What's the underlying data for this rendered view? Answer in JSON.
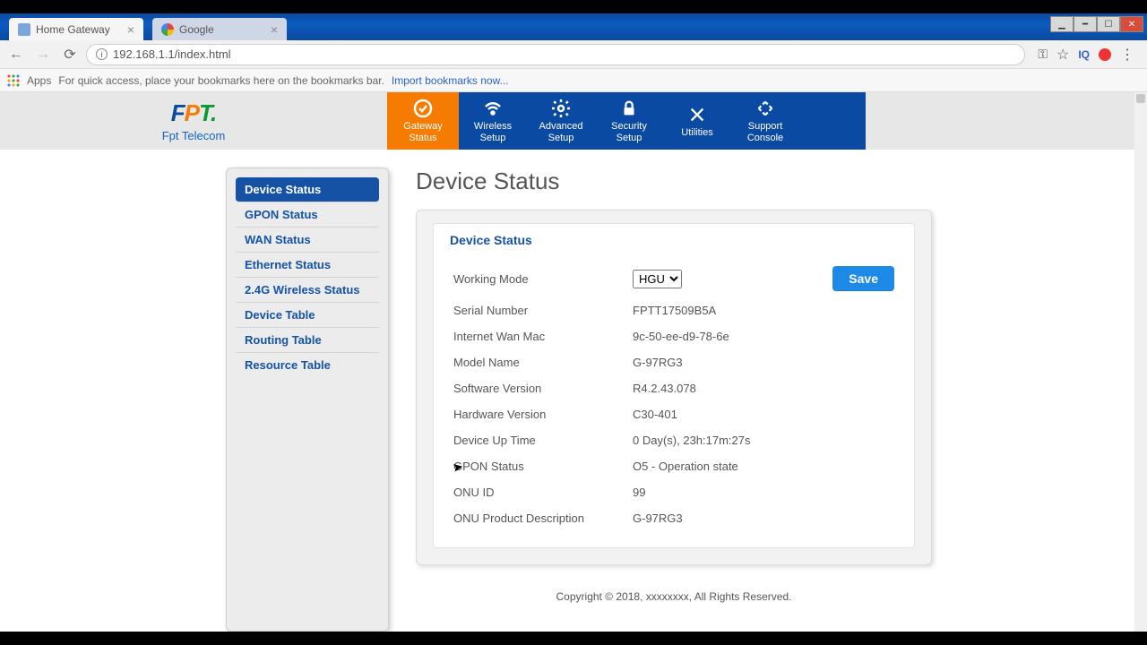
{
  "browser": {
    "tabs": [
      {
        "title": "Home Gateway"
      },
      {
        "title": "Google"
      }
    ],
    "url": "192.168.1.1/index.html",
    "apps_label": "Apps",
    "bookmark_hint": "For quick access, place your bookmarks here on the bookmarks bar.",
    "import_link": "Import bookmarks now..."
  },
  "brand": {
    "name_f": "F",
    "name_p": "P",
    "name_t": "T",
    "dot": ".",
    "sub": "Fpt Telecom"
  },
  "topnav": [
    {
      "label1": "Gateway",
      "label2": "Status"
    },
    {
      "label1": "Wireless",
      "label2": "Setup"
    },
    {
      "label1": "Advanced",
      "label2": "Setup"
    },
    {
      "label1": "Security",
      "label2": "Setup"
    },
    {
      "label1": "Utilities",
      "label2": ""
    },
    {
      "label1": "Support",
      "label2": "Console"
    }
  ],
  "sidebar": [
    "Device Status",
    "GPON Status",
    "WAN Status",
    "Ethernet Status",
    "2.4G Wireless Status",
    "Device Table",
    "Routing Table",
    "Resource Table"
  ],
  "page_title": "Device Status",
  "panel_head": "Device Status",
  "working_mode_label": "Working Mode",
  "working_mode_value": "HGU",
  "save_label": "Save",
  "rows": [
    {
      "k": "Serial Number",
      "v": "FPTT17509B5A"
    },
    {
      "k": "Internet Wan Mac",
      "v": "9c-50-ee-d9-78-6e"
    },
    {
      "k": "Model Name",
      "v": "G-97RG3"
    },
    {
      "k": "Software Version",
      "v": "R4.2.43.078"
    },
    {
      "k": "Hardware Version",
      "v": "C30-401"
    },
    {
      "k": "Device Up Time",
      "v": "0 Day(s), 23h:17m:27s"
    },
    {
      "k": "GPON Status",
      "v": "O5 - Operation state"
    },
    {
      "k": "ONU ID",
      "v": "99"
    },
    {
      "k": "ONU Product Description",
      "v": "G-97RG3"
    }
  ],
  "footer": "Copyright © 2018, xxxxxxxx, All Rights Reserved."
}
